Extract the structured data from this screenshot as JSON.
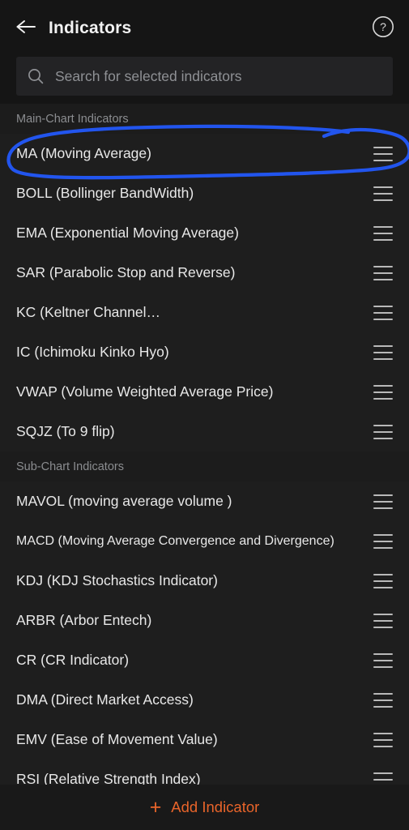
{
  "header": {
    "title": "Indicators",
    "back_icon": "back-arrow-icon",
    "help_icon": "help-circle-icon"
  },
  "search": {
    "placeholder": "Search for selected indicators",
    "value": "",
    "icon": "search-icon"
  },
  "sections": [
    {
      "title": "Main-Chart Indicators",
      "items": [
        {
          "label": "MA (Moving Average)",
          "handle": "drag-handle-icon",
          "annotated": true
        },
        {
          "label": "BOLL (Bollinger BandWidth)",
          "handle": "drag-handle-icon"
        },
        {
          "label": "EMA (Exponential Moving Average)",
          "handle": "drag-handle-icon"
        },
        {
          "label": "SAR (Parabolic Stop and Reverse)",
          "handle": "drag-handle-icon"
        },
        {
          "label": "KC (Keltner Channel…",
          "handle": "drag-handle-icon"
        },
        {
          "label": "IC (Ichimoku Kinko Hyo)",
          "handle": "drag-handle-icon"
        },
        {
          "label": "VWAP (Volume Weighted Average Price)",
          "handle": "drag-handle-icon"
        },
        {
          "label": "SQJZ (To 9 flip)",
          "handle": "drag-handle-icon"
        }
      ]
    },
    {
      "title": "Sub-Chart Indicators",
      "items": [
        {
          "label": "MAVOL (moving average volume )",
          "handle": "drag-handle-icon"
        },
        {
          "label": "MACD (Moving Average Convergence and Divergence)",
          "handle": "drag-handle-icon",
          "small": true
        },
        {
          "label": "KDJ (KDJ Stochastics Indicator)",
          "handle": "drag-handle-icon"
        },
        {
          "label": "ARBR (Arbor Entech)",
          "handle": "drag-handle-icon"
        },
        {
          "label": "CR (CR Indicator)",
          "handle": "drag-handle-icon"
        },
        {
          "label": "DMA (Direct Market Access)",
          "handle": "drag-handle-icon"
        },
        {
          "label": "EMV (Ease of Movement Value)",
          "handle": "drag-handle-icon"
        },
        {
          "label": "RSI (Relative Strength Index)",
          "handle": "drag-handle-icon"
        }
      ]
    }
  ],
  "footer": {
    "label": "Add Indicator",
    "plus": "+",
    "icon": "plus-icon"
  },
  "annotation": {
    "shape": "hand-drawn-ellipse",
    "color": "#2255ee",
    "target": "MA (Moving Average)"
  },
  "colors": {
    "background": "#151515",
    "row": "#1e1e1e",
    "section_band": "#1c1c1c",
    "search_field": "#232325",
    "text_primary": "#e8e8e8",
    "text_muted": "#8b8d90",
    "accent": "#e8642a",
    "annotation": "#2255ee"
  }
}
